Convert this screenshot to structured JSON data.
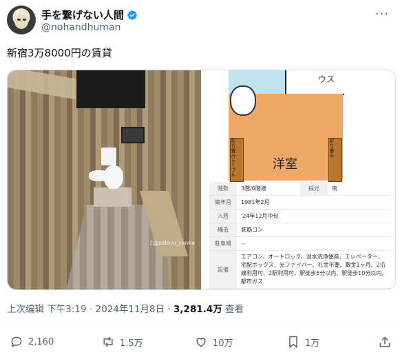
{
  "author": {
    "display_name": "手を繋げない人間",
    "handle": "@nohandhuman",
    "avatar_icon": "avatar-illustration",
    "verified_icon": "verified-badge-icon"
  },
  "tweet": {
    "text": "新宿3万8000円の賃貸"
  },
  "media": {
    "watermark": "♪@satoru_sanka",
    "floorplan": {
      "room_label": "洋室",
      "top_right_label": "ウス",
      "left_closet": "折り畳みテーブル",
      "right_closet": "折り畳み"
    },
    "info_rows": [
      {
        "label": "階数",
        "value": "3階/6階建",
        "label2": "採光",
        "value2": "南"
      },
      {
        "label": "築年月",
        "value": "1981年2月"
      },
      {
        "label": "入居",
        "value": "'24年12月中旬"
      },
      {
        "label": "構造",
        "value": "鉄筋コン"
      },
      {
        "label": "駐車場",
        "value": "--"
      },
      {
        "label": "設備",
        "value": "エアコン、オートロック、温水洗浄便座、エレベーター、宅配ボックス、光ファイバー、礼金不要、敷金1ヶ月、2沿線利用可、2駅利用可、駅徒歩5分以内、駅徒歩10分以内、都市ガス"
      }
    ]
  },
  "meta": {
    "edited": "上次编辑",
    "time": "下午3:19",
    "sep": "·",
    "date": "2024年11月8日",
    "views": "3,281.4万",
    "views_label": "查看"
  },
  "actions": {
    "replies": "2,160",
    "reposts": "1.5万",
    "likes": "10万",
    "bookmarks": "1万"
  },
  "colors": {
    "text": "#0f1419",
    "secondary": "#536471",
    "verified": "#1d9bf0"
  }
}
